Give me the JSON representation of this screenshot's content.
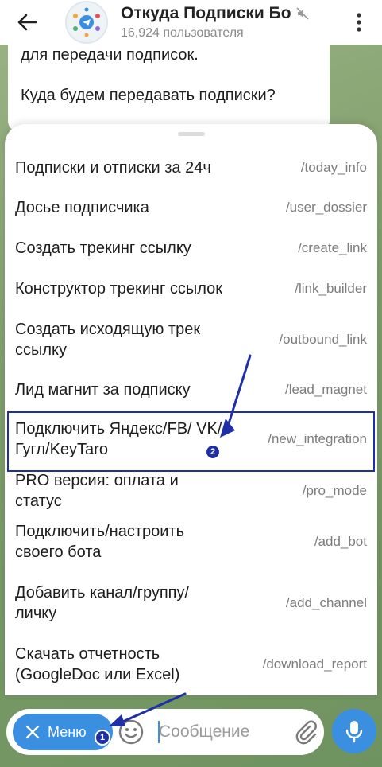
{
  "header": {
    "title": "Откуда Подписки Бо",
    "subtitle": "16,924 пользователя"
  },
  "message": {
    "line1": "для передачи подписок.",
    "line2": "Куда будем передавать подписки?"
  },
  "commands": [
    {
      "description": "Подписки и отписки за 24ч",
      "command": "/today_info"
    },
    {
      "description": "Досье подписчика",
      "command": "/user_dossier"
    },
    {
      "description": "Создать трекинг ссылку",
      "command": "/create_link"
    },
    {
      "description": "Конструктор трекинг ссылок",
      "command": "/link_builder"
    },
    {
      "description": "Создать исходящую трек ссылку",
      "command": "/outbound_link"
    },
    {
      "description": "Лид магнит за подписку",
      "command": "/lead_magnet"
    },
    {
      "description": "Подключить Яндекс/FB/ VK/Гугл/KeyTaro",
      "command": "/new_integration"
    },
    {
      "description": "PRO версия: оплата и статус",
      "command": "/pro_mode"
    },
    {
      "description": "Подключить/настроить своего бота",
      "command": "/add_bot"
    },
    {
      "description": "Добавить канал/группу/ личку",
      "command": "/add_channel"
    },
    {
      "description": "Скачать отчетность (GoogleDoc или Excel)",
      "command": "/download_report"
    }
  ],
  "input_bar": {
    "menu_label": "Меню",
    "placeholder": "Сообщение"
  },
  "annotations": {
    "badge1": "1",
    "badge2": "2"
  },
  "colors": {
    "accent": "#3b8fe0",
    "annotation": "#1f2fa6"
  },
  "icons": [
    "back-arrow-icon",
    "bot-avatar-icon",
    "mute-icon",
    "more-vert-icon",
    "close-icon",
    "emoji-icon",
    "paperclip-icon",
    "mic-icon"
  ]
}
